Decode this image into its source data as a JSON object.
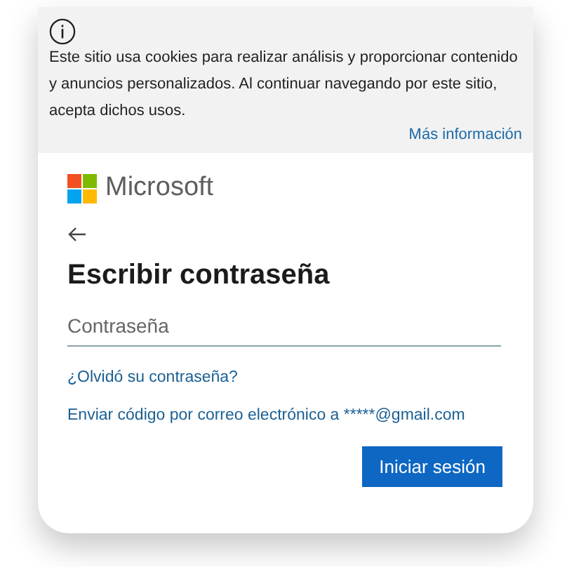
{
  "cookie_banner": {
    "text": "Este sitio usa cookies para realizar análisis y proporcionar contenido y anuncios personalizados. Al continuar navegando por este sitio, acepta dichos usos.",
    "link": "Más información"
  },
  "brand": {
    "name": "Microsoft"
  },
  "title": "Escribir contraseña",
  "password_field": {
    "placeholder": "Contraseña"
  },
  "links": [
    "¿Olvidó su contraseña?",
    "Enviar código por correo electrónico a *****@gmail.com"
  ],
  "buttons": [
    {
      "label": "Iniciar sesión",
      "kind": "primary"
    }
  ]
}
